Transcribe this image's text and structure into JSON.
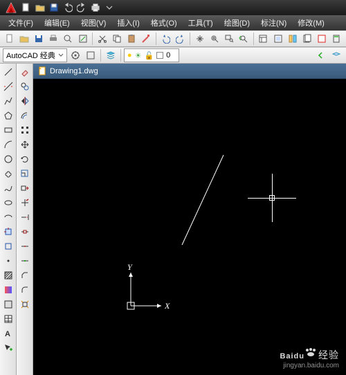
{
  "app": {
    "name": "AutoCAD"
  },
  "menu": {
    "file": "文件(F)",
    "edit": "编辑(E)",
    "view": "视图(V)",
    "insert": "插入(I)",
    "format": "格式(O)",
    "tools": "工具(T)",
    "draw": "绘图(D)",
    "dimension": "标注(N)",
    "modify": "修改(M)"
  },
  "workspace": {
    "current": "AutoCAD 经典"
  },
  "layer": {
    "current": "0"
  },
  "document": {
    "title": "Drawing1.dwg"
  },
  "ucs": {
    "x_label": "X",
    "y_label": "Y"
  },
  "watermark": {
    "brand": "Baidu",
    "suffix": "经验",
    "url": "jingyan.baidu.com"
  }
}
